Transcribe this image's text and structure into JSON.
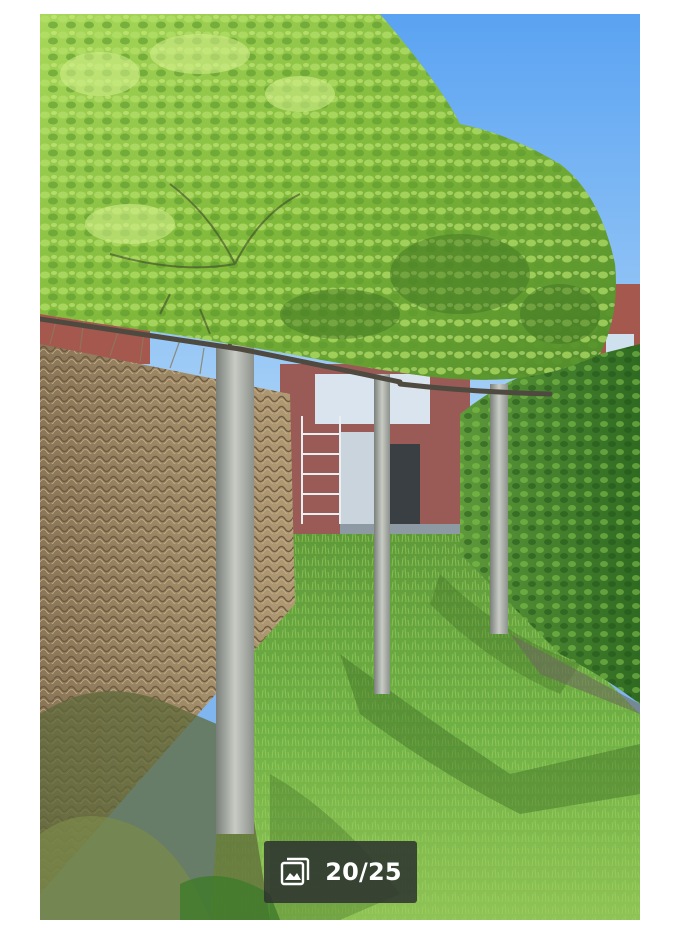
{
  "gallery": {
    "counter": {
      "current": 20,
      "total": 25,
      "text": "20/25",
      "icon": "image-gallery-icon"
    }
  },
  "colors": {
    "badge_background": "#2d3230",
    "badge_text": "#ffffff",
    "page_background": "#ffffff"
  }
}
